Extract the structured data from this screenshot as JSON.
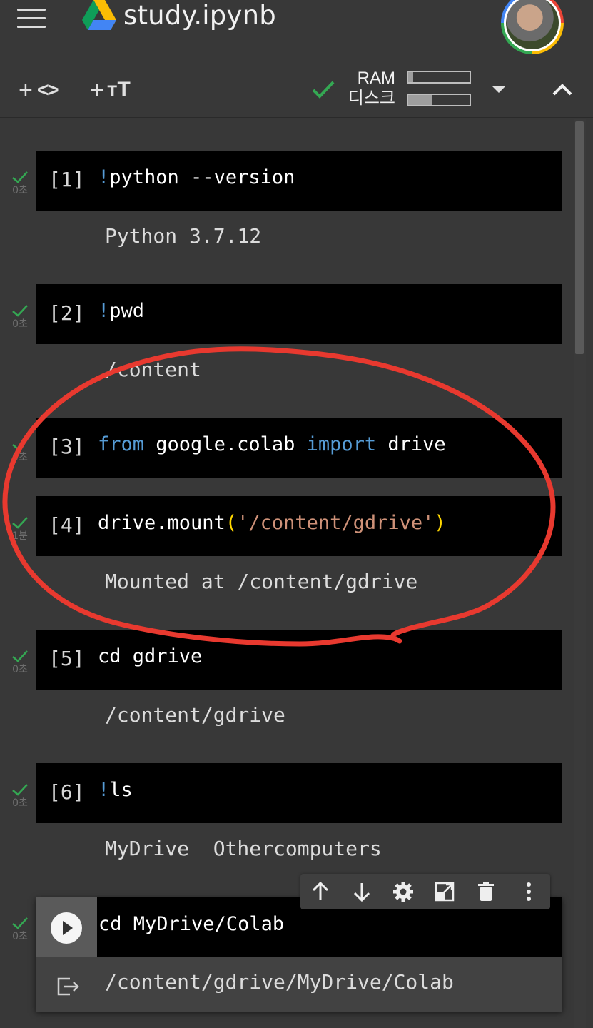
{
  "header": {
    "menu_icon": "hamburger-menu-icon",
    "logo_icon": "google-drive-icon",
    "title": "study.ipynb",
    "avatar_icon": "user-avatar"
  },
  "toolbar": {
    "add_code": "+ <>",
    "add_text": "+ TT",
    "connected_icon": "check-icon",
    "ram_label": "RAM",
    "disk_label": "디스크",
    "ram_usage_fraction": 0.08,
    "disk_usage_fraction": 0.38,
    "dropdown_icon": "caret-down-icon",
    "collapse_icon": "chevron-up-icon"
  },
  "cells": [
    {
      "number": "[1]",
      "bang": "!",
      "code": "python --version",
      "time": "0초",
      "output": "Python 3.7.12"
    },
    {
      "number": "[2]",
      "bang": "!",
      "code": "pwd",
      "time": "0초",
      "output": "/content"
    },
    {
      "number": "[3]",
      "kw1": "from",
      "mid": " google.colab ",
      "kw2": "import",
      "tail": " drive",
      "time": "0초",
      "output": ""
    },
    {
      "number": "[4]",
      "pre": "drive.mount",
      "open": "(",
      "str": "'/content/gdrive'",
      "close": ")",
      "time": "1분",
      "output": "Mounted at /content/gdrive"
    },
    {
      "number": "[5]",
      "code": "cd gdrive",
      "time": "0초",
      "output": "/content/gdrive"
    },
    {
      "number": "[6]",
      "bang": "!",
      "code": "ls",
      "time": "0초",
      "output": "MyDrive  Othercomputers"
    }
  ],
  "selected_cell": {
    "code": "cd MyDrive/Colab",
    "time": "0초",
    "output": "/content/gdrive/MyDrive/Colab",
    "run_icon": "play-icon",
    "output_icon": "output-exit-icon"
  },
  "cell_tools": [
    "arrow-up-icon",
    "arrow-down-icon",
    "gear-icon",
    "link-cell-icon",
    "trash-icon",
    "more-vert-icon"
  ],
  "colors": {
    "background": "#383838",
    "cell_bg": "#000000",
    "keyword": "#569cd6",
    "string": "#ce9178",
    "check": "#34a853",
    "annotation": "#e8392f"
  }
}
